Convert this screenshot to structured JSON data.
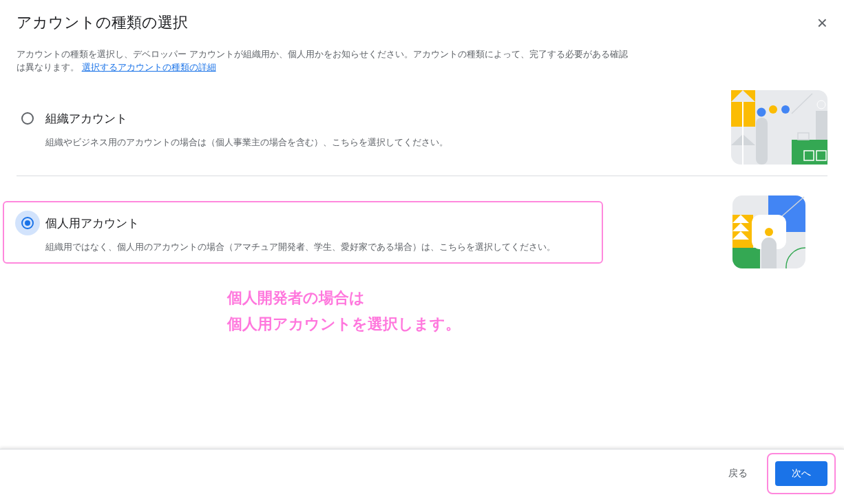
{
  "dialog": {
    "title": "アカウントの種類の選択",
    "close": "×",
    "description": "アカウントの種類を選択し、デベロッパー アカウントが組織用か、個人用かをお知らせください。アカウントの種類によって、完了する必要がある確認は異なります。",
    "link": "選択するアカウントの種類の詳細"
  },
  "options": [
    {
      "kind": "organization",
      "label": "組織アカウント",
      "description": "組織やビジネス用のアカウントの場合は（個人事業主の場合を含む）、こちらを選択してください。",
      "selected": false,
      "highlighted": false
    },
    {
      "kind": "personal",
      "label": "個人用アカウント",
      "description": "組織用ではなく、個人用のアカウントの場合（アマチュア開発者、学生、愛好家である場合）は、こちらを選択してください。",
      "selected": true,
      "highlighted": true
    }
  ],
  "annotation": [
    "個人開発者の場合は",
    "個人用アカウントを選択します。"
  ],
  "footer": {
    "back": "戻る",
    "next": "次へ",
    "next_highlighted": true
  }
}
